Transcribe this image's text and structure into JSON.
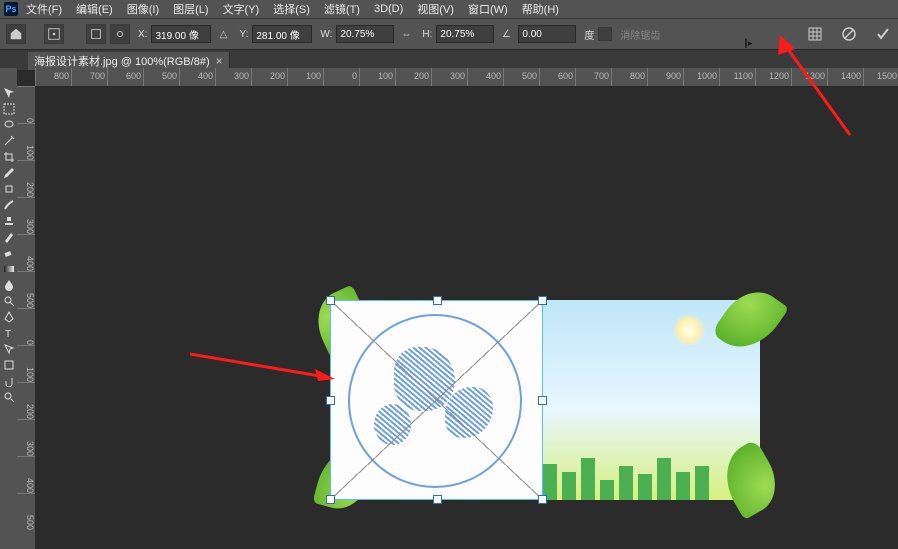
{
  "menu": {
    "items": [
      "文件(F)",
      "编辑(E)",
      "图像(I)",
      "图层(L)",
      "文字(Y)",
      "选择(S)",
      "滤镜(T)",
      "3D(D)",
      "视图(V)",
      "窗口(W)",
      "帮助(H)"
    ]
  },
  "options": {
    "x_label": "X:",
    "x_value": "319.00 像",
    "y_label": "Y:",
    "y_value": "281.00 像",
    "w_label": "W:",
    "w_value": "20.75%",
    "h_label": "H:",
    "h_value": "20.75%",
    "angle_value": "0.00",
    "angle_unit": "度",
    "clear_warp": "消除锯齿"
  },
  "tab": {
    "title": "海报设计素材.jpg @ 100%(RGB/8#)",
    "close": "×"
  },
  "ruler_h": [
    "800",
    "700",
    "600",
    "500",
    "400",
    "300",
    "200",
    "100",
    "0",
    "100",
    "200",
    "300",
    "400",
    "500",
    "600",
    "700",
    "800",
    "900",
    "1000",
    "1100",
    "1200",
    "1300",
    "1400",
    "1500"
  ],
  "ruler_v": [
    "0",
    "100",
    "200",
    "300",
    "400",
    "500",
    "0",
    "100",
    "200",
    "300",
    "400",
    "500"
  ],
  "actions": {
    "warp": "warp",
    "cancel": "cancel",
    "commit": "commit"
  },
  "icons": {
    "move": "move",
    "marquee": "marquee",
    "lasso": "lasso",
    "wand": "wand",
    "crop": "crop",
    "eyedrop": "eyedrop",
    "patch": "patch",
    "brush": "brush",
    "stamp": "stamp",
    "history": "history",
    "eraser": "eraser",
    "gradient": "gradient",
    "blur": "blur",
    "dodge": "dodge",
    "pen": "pen",
    "text": "text",
    "path": "path",
    "shape": "shape",
    "hand": "hand",
    "zoom": "zoom"
  }
}
